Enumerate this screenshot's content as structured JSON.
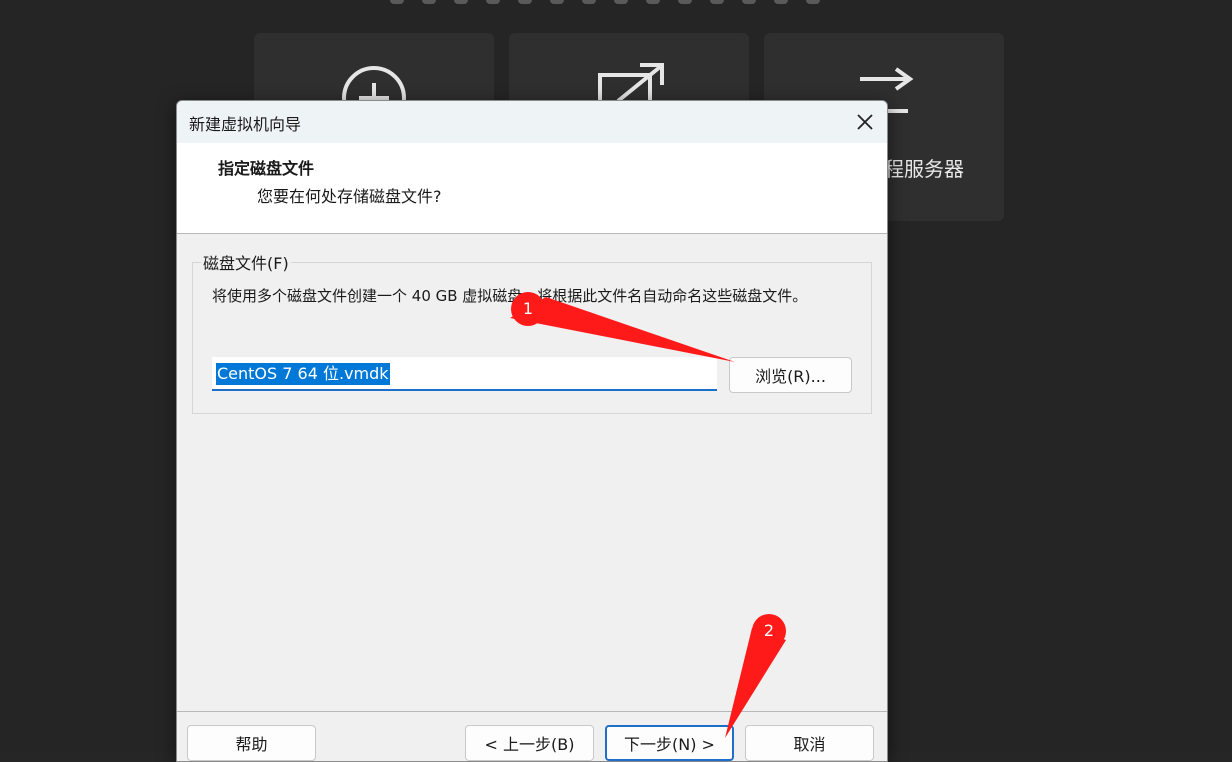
{
  "background": {
    "tile_label_3": "程服务器"
  },
  "dialog": {
    "title": "新建虚拟机向导",
    "header_title": "指定磁盘文件",
    "header_subtitle": "您要在何处存储磁盘文件?",
    "group_label": "磁盘文件(F)",
    "group_description": "将使用多个磁盘文件创建一个 40 GB 虚拟磁盘。将根据此文件名自动命名这些磁盘文件。",
    "file_value": "CentOS 7 64 位.vmdk",
    "browse_label": "浏览(R)...",
    "help_label": "帮助",
    "back_label": "< 上一步(B)",
    "next_label": "下一步(N) >",
    "cancel_label": "取消"
  },
  "annotations": {
    "badge_1": "1",
    "badge_2": "2",
    "color": "#ff1a1a"
  }
}
